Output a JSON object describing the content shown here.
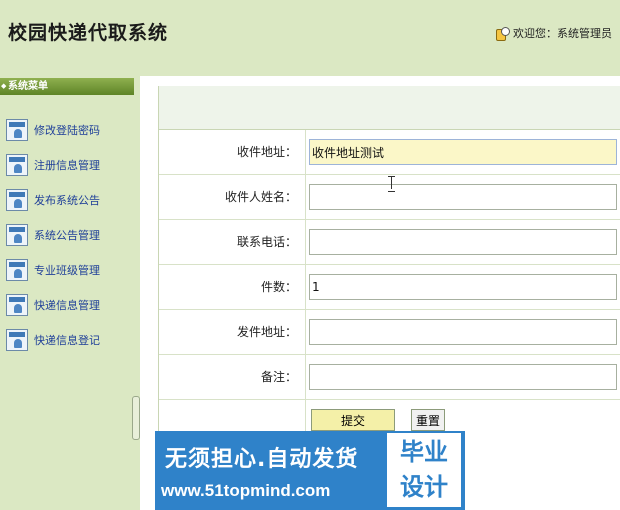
{
  "header": {
    "title": "校园快递代取系统",
    "welcome": "欢迎您：系统管理员"
  },
  "sidebar": {
    "menu_title": "系统菜单",
    "items": [
      {
        "label": "修改登陆密码"
      },
      {
        "label": "注册信息管理"
      },
      {
        "label": "发布系统公告"
      },
      {
        "label": "系统公告管理"
      },
      {
        "label": "专业班级管理"
      },
      {
        "label": "快递信息管理"
      },
      {
        "label": "快递信息登记"
      }
    ]
  },
  "form": {
    "fields": [
      {
        "label": "收件地址：",
        "value": "收件地址测试"
      },
      {
        "label": "收件人姓名：",
        "value": ""
      },
      {
        "label": "联系电话：",
        "value": ""
      },
      {
        "label": "件数：",
        "value": "1"
      },
      {
        "label": "发件地址：",
        "value": ""
      },
      {
        "label": "备注：",
        "value": ""
      }
    ],
    "submit_label": "提交",
    "reset_label": "重置"
  },
  "watermark": {
    "line1": "无须担心.自动发货",
    "line2": "www.51topmind.com",
    "box_top": "毕业",
    "box_bottom": "设计"
  },
  "colors": {
    "background": "#dbe8c3",
    "menu_header": "#6f9434",
    "link": "#1f3f99",
    "watermark": "#2f82c9"
  }
}
